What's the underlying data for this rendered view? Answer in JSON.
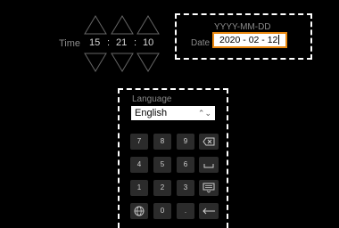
{
  "time": {
    "label": "Time",
    "hour": "15",
    "minute": "21",
    "second": "10",
    "separator": ":"
  },
  "date": {
    "format_hint": "YYYY-MM-DD",
    "label": "Date",
    "value": "2020 - 02 - 12"
  },
  "language": {
    "label": "Language",
    "selected": "English"
  },
  "keypad": {
    "row1": [
      "7",
      "8",
      "9"
    ],
    "row2": [
      "4",
      "5",
      "6"
    ],
    "row3": [
      "1",
      "2",
      "3"
    ],
    "row4_middle": [
      "0",
      "."
    ],
    "special": {
      "backspace_icon": "backspace-icon",
      "space_icon": "space-icon",
      "keyboard_icon": "keyboard-icon",
      "globe_icon": "globe-icon",
      "enter_icon": "enter-icon"
    }
  },
  "colors": {
    "background": "#000000",
    "accent": "#e8870f",
    "key": "#2b2b2b",
    "dashed_border": "#ffffff"
  }
}
